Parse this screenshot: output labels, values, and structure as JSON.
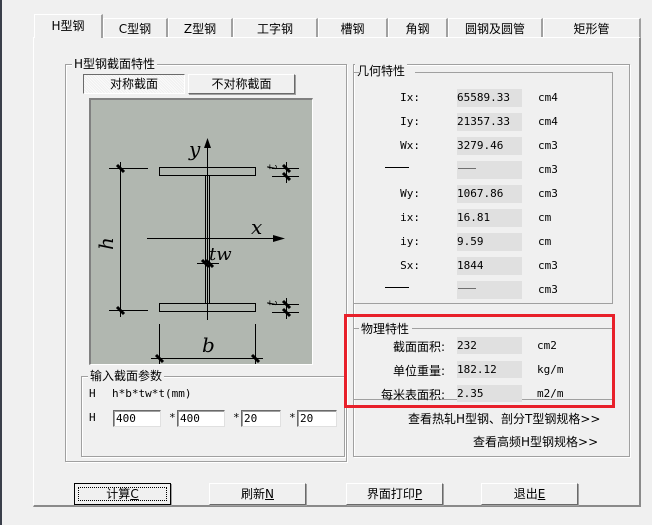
{
  "tabs": [
    {
      "label": "H型钢",
      "active": true
    },
    {
      "label": "C型钢",
      "active": false
    },
    {
      "label": "Z型钢",
      "active": false
    },
    {
      "label": "工字钢",
      "active": false
    },
    {
      "label": "槽钢",
      "active": false
    },
    {
      "label": "角钢",
      "active": false
    },
    {
      "label": "圆钢及圆管",
      "active": false
    },
    {
      "label": "矩形管",
      "active": false
    }
  ],
  "section": {
    "title": "H型钢截面特性",
    "symmetric_label": "对称截面",
    "asymmetric_label": "不对称截面",
    "selected": "对称截面"
  },
  "drawing": {
    "labels": {
      "y": "y",
      "x": "x",
      "h": "h",
      "b": "b",
      "tw": "tw",
      "t_top": "t",
      "t_bottom": "t"
    }
  },
  "input": {
    "title": "输入截面参数",
    "type_prefix": "H",
    "format_label": "h*b*tw*t(mm)",
    "row_prefix": "H",
    "separator": "*",
    "h": "400",
    "b": "400",
    "tw": "20",
    "t": "20"
  },
  "geometry": {
    "title": "几何特性",
    "rows": [
      {
        "label": "Ix:",
        "value": "65589.33",
        "unit": "cm4",
        "dashed": false
      },
      {
        "label": "Iy:",
        "value": "21357.33",
        "unit": "cm4",
        "dashed": false
      },
      {
        "label": "Wx:",
        "value": "3279.46",
        "unit": "cm3",
        "dashed": false
      },
      {
        "label": "",
        "value": "",
        "unit": "cm3",
        "dashed": true
      },
      {
        "label": "Wy:",
        "value": "1067.86",
        "unit": "cm3",
        "dashed": false
      },
      {
        "label": "ix:",
        "value": "16.81",
        "unit": "cm",
        "dashed": false
      },
      {
        "label": "iy:",
        "value": "9.59",
        "unit": "cm",
        "dashed": false
      },
      {
        "label": "Sx:",
        "value": "1844",
        "unit": "cm3",
        "dashed": false
      },
      {
        "label": "",
        "value": "",
        "unit": "cm3",
        "dashed": true
      }
    ]
  },
  "physical": {
    "title": "物理特性",
    "rows": [
      {
        "label": "截面面积:",
        "value": "232",
        "unit": "cm2"
      },
      {
        "label": "单位重量:",
        "value": "182.12",
        "unit": "kg/m"
      },
      {
        "label": "每米表面积:",
        "value": "2.35",
        "unit": "m2/m"
      }
    ],
    "highlight_color": "#e8202a"
  },
  "links": {
    "hot_rolled": "查看热轧H型钢、剖分T型钢规格>>",
    "high_freq": "查看高频H型钢规格>>"
  },
  "buttons": {
    "calc": {
      "label": "计算",
      "hotkey": "C"
    },
    "refresh": {
      "label": "刷新",
      "hotkey": "N"
    },
    "print": {
      "label": "界面打印",
      "hotkey": "P"
    },
    "exit": {
      "label": "退出",
      "hotkey": "E"
    }
  }
}
